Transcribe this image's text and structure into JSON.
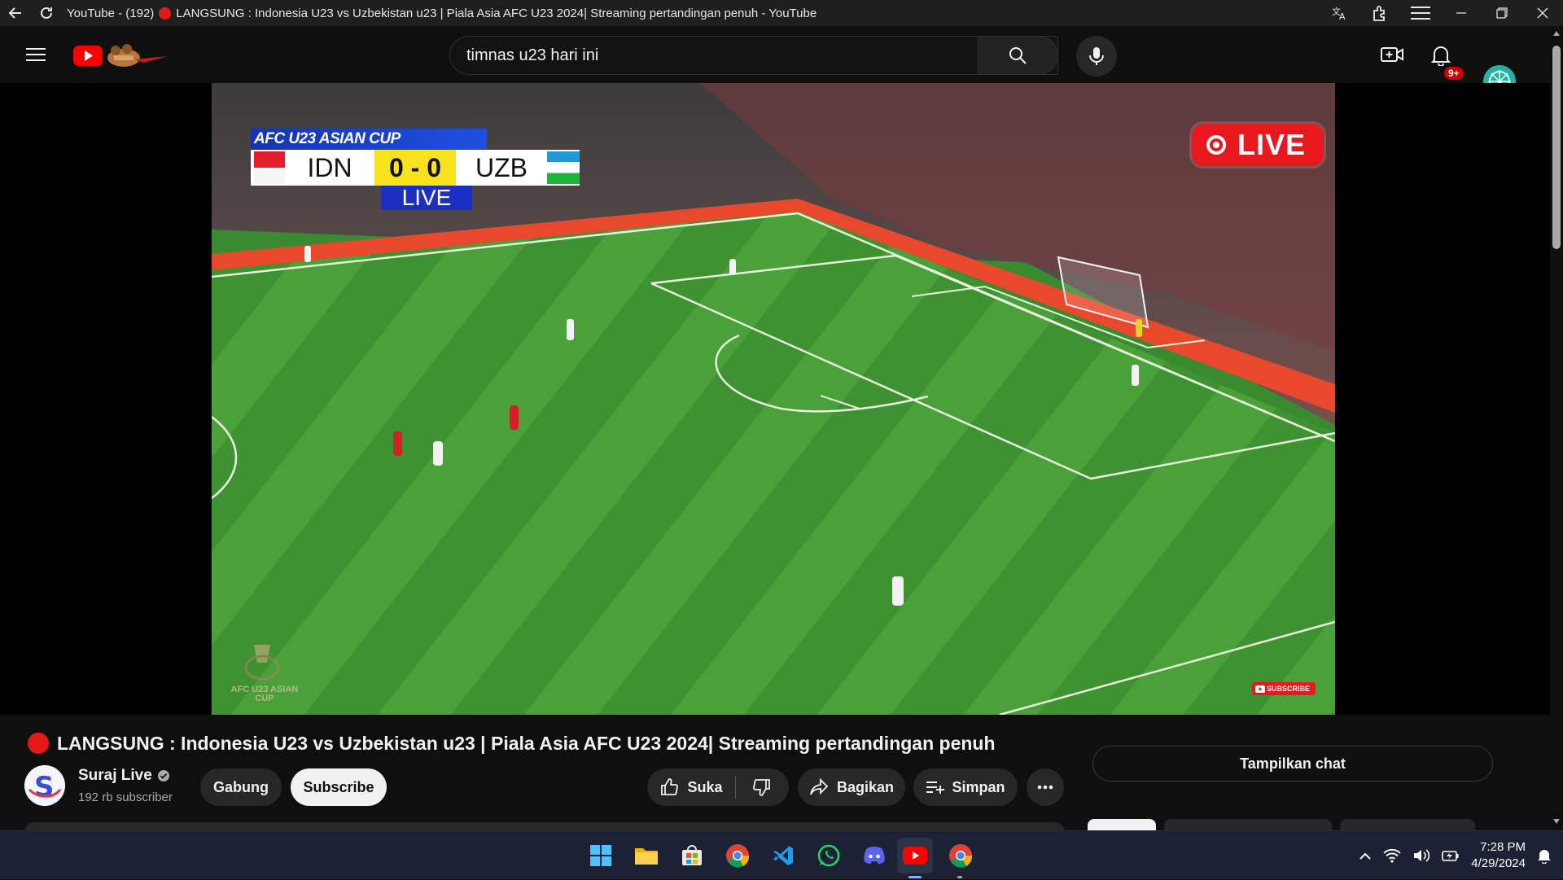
{
  "window": {
    "title": "YouTube - (192)",
    "title_rest": "LANGSUNG : Indonesia U23 vs Uzbekistan u23 | Piala Asia AFC U23 2024| Streaming pertandingan penuh - YouTube"
  },
  "search": {
    "query": "timnas u23 hari ini"
  },
  "notifications": {
    "badge": "9+"
  },
  "video": {
    "scoreboard": {
      "competition": "AFC U23 ASIAN CUP",
      "home": "IDN",
      "away": "UZB",
      "score": "0 - 0",
      "status": "LIVE"
    },
    "live_badge": "LIVE",
    "subscribe_watermark": "SUBSCRIBE",
    "corner_logo": "AFC U23 ASIAN CUP"
  },
  "watch": {
    "title": "LANGSUNG : Indonesia U23 vs Uzbekistan u23 | Piala Asia AFC U23 2024| Streaming pertandingan penuh",
    "channel_name": "Suraj Live",
    "subscribers": "192 rb subscriber",
    "join_label": "Gabung",
    "subscribe_label": "Subscribe",
    "like_label": "Suka",
    "share_label": "Bagikan",
    "save_label": "Simpan",
    "chat_label": "Tampilkan chat"
  },
  "taskbar": {
    "apps": [
      "windows-start-icon",
      "file-explorer-icon",
      "microsoft-store-icon",
      "chrome-icon",
      "vscode-icon",
      "whatsapp-icon",
      "discord-icon",
      "youtube-app-icon",
      "chrome-profile-icon"
    ],
    "time": "7:28 PM",
    "date": "4/29/2024"
  },
  "colors": {
    "background": "#0f0f0f",
    "accent_red": "#e61919",
    "pitch_green": "#3a8a2f",
    "taskbar": "#1c2233"
  }
}
